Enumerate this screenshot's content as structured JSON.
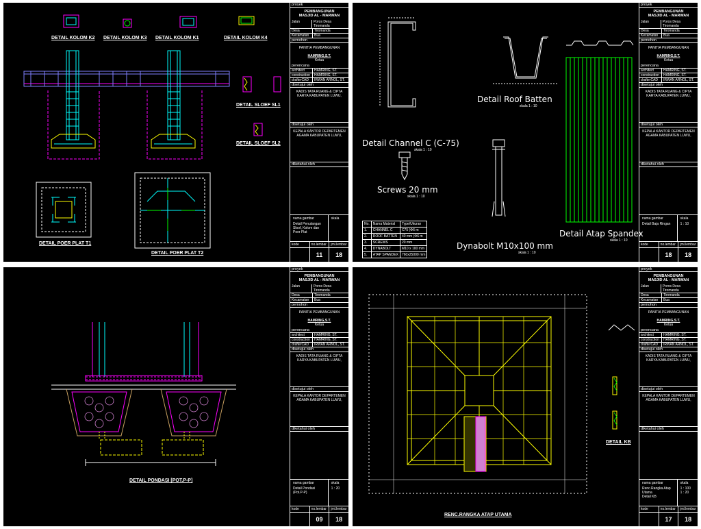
{
  "colors": {
    "concrete": "#ff00ff",
    "rebar": "#00ffff",
    "slab": "#8080ff",
    "beam": "#ffff00",
    "steel": "#00ff00",
    "footing_fill": "#d080d0",
    "earth": "#c8a060",
    "sheet_bg": "#000000",
    "line": "#ffffff"
  },
  "title_block": {
    "proyek_label": "proyek",
    "project": [
      "PEMBANGUNAN",
      "MASJID AL - MARWAN"
    ],
    "rows": [
      {
        "k": "Jalan",
        "v": "Poros Desa Tiromanda"
      },
      {
        "k": "Desa",
        "v": "Tiromanda"
      },
      {
        "k": "Kecamatan",
        "v": "Bua"
      }
    ],
    "pemohon_label": "pemohon",
    "pemohon": "PANITIA PEMBANGUNAN",
    "pemohon_name": "HAMRING,S.T.",
    "pemohon_role": "Ketua",
    "perencana_label": "perencana",
    "perencana": [
      {
        "k": "architect",
        "v": "HAMRING, ST."
      },
      {
        "k": "construction",
        "v": "HAMRING, ST."
      },
      {
        "k": "drafterCAD",
        "v": "IRWAN ARNOL, ST."
      }
    ],
    "disetujui_label": "disetujui oleh",
    "disetujui_1": "KADIS TATA RUANG & CIPTA KARYA KABUPATEN LUWU,",
    "disetujui_2": "KEPALA KANTOR DEPARTEMEN AGAMA KABUPATEN LUWU,",
    "diketahui_label": "diketahui oleh",
    "nama_gambar_label": "nama gambar",
    "skala_label": "skala",
    "kode_label": "kode",
    "no_lembar_label": "no.lembar",
    "jml_lembar_label": "jml.lembar"
  },
  "sheets": [
    {
      "nama_gambar": "Detail Penulangan Sloof, Kolom dan Poer Plat",
      "skala": "",
      "no_lembar": "11",
      "jml_lembar": "18",
      "labels": {
        "k2": "DETAIL KOLOM K2",
        "k3": "DETAIL KOLOM K3",
        "k1": "DETAIL KOLOM K1",
        "k4": "DETAIL KOLOM K4",
        "sl1": "DETAIL SLOEF SL1",
        "sl2": "DETAIL SLOEF SL2",
        "t1": "DETAIL POER PLAT T1",
        "t2": "DETAIL POER PLAT T2"
      }
    },
    {
      "nama_gambar": "Detail Baja Ringan",
      "skala": "1 : 10",
      "no_lembar": "18",
      "jml_lembar": "18",
      "labels": {
        "channel": "Detail Channel C  (C-75)",
        "channel_scale": "skala  1 : 10",
        "batten": "Detail Roof Batten",
        "batten_scale": "skala  1 : 10",
        "screws": "Screws 20 mm",
        "screws_scale": "skala  1 : 10",
        "dynabolt": "Dynabolt M10x100 mm",
        "dynabolt_scale": "skala  1 : 10",
        "spandex": "Detail Atap Spandex",
        "spandex_scale": "skala  1 : 10"
      },
      "material_table": {
        "headers": [
          "No.",
          "Nama Material",
          "Type/Ukuran"
        ],
        "rows": [
          [
            "1.",
            "CHANNEL C",
            "C75 (Φ6 m"
          ],
          [
            "2.",
            "ROOF BATTEN",
            "40 mm (Φ6 m"
          ],
          [
            "3.",
            "SCREWS",
            "20 mm"
          ],
          [
            "4.",
            "DYNABOLT",
            "M10 x 100 mm"
          ],
          [
            "5.",
            "ATAP SPANDEX",
            "760x25000 mm"
          ]
        ]
      }
    },
    {
      "nama_gambar": "Detail Pondasi (Pot.P-P)",
      "skala": "1 : 20",
      "no_lembar": "09",
      "jml_lembar": "18",
      "labels": {
        "title": "DETAIL PONDASI [POT.P-P]"
      }
    },
    {
      "nama_gambar": "Renc.Rangka Atap Utama\nDetail KB",
      "skala": "1 : 100\n1 : 20",
      "no_lembar": "17",
      "jml_lembar": "18",
      "labels": {
        "title": "RENC.RANGKA ATAP UTAMA",
        "kb": "DETAIL KB"
      }
    }
  ]
}
